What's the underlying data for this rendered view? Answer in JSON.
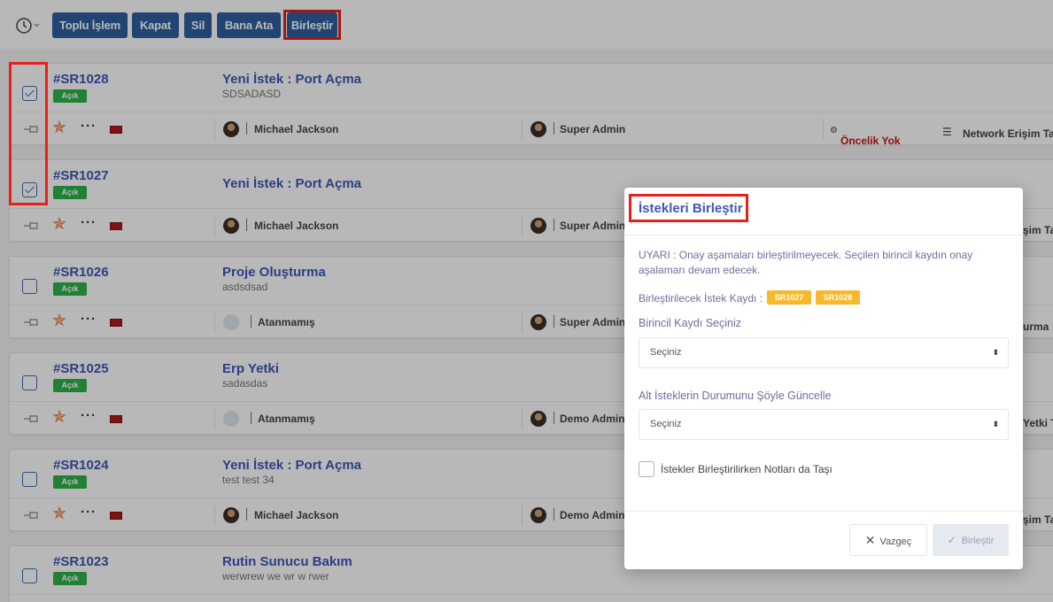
{
  "toolbar": {
    "buttons": [
      "Toplu İşlem",
      "Kapat",
      "Sil",
      "Bana Ata",
      "Birleştir"
    ]
  },
  "requests": [
    {
      "id": "#SR1028",
      "status": "Açık",
      "title": "Yeni İstek : Port Açma",
      "subtitle": "SDSADASD",
      "assignee": "Michael Jackson",
      "owner": "Super Admin",
      "checked": true
    },
    {
      "id": "#SR1027",
      "status": "Açık",
      "title": "Yeni İstek : Port Açma",
      "subtitle": "",
      "assignee": "Michael Jackson",
      "owner": "Super Admin",
      "checked": true
    },
    {
      "id": "#SR1026",
      "status": "Açık",
      "title": "Proje Oluşturma",
      "subtitle": "asdsdsad",
      "assignee": "Atanmamış",
      "owner": "Super Admin",
      "checked": false
    },
    {
      "id": "#SR1025",
      "status": "Açık",
      "title": "Erp Yetki",
      "subtitle": "sadasdas",
      "assignee": "Atanmamış",
      "owner": "Demo Admin",
      "checked": false
    },
    {
      "id": "#SR1024",
      "status": "Açık",
      "title": "Yeni İstek : Port Açma",
      "subtitle": "test test 34",
      "assignee": "Michael Jackson",
      "owner": "Demo Admin",
      "checked": false
    },
    {
      "id": "#SR1023",
      "status": "Açık",
      "title": "Rutin Sunucu Bakım",
      "subtitle": "werwrew we wr w rwer",
      "assignee": "",
      "owner": "",
      "checked": false
    }
  ],
  "first_row_extra": {
    "priority": "Öncelik Yok",
    "category": "Network Erişim Ta"
  },
  "row_clipped_category": [
    "şim Ta",
    "urma",
    "Yetki Ta",
    "şim Ta"
  ],
  "modal": {
    "title": "İstekleri Birleştir",
    "warning": "UYARI : Onay aşamaları birleştirilmeyecek. Seçilen birincil kaydın onay aşalamarı devam edecek.",
    "merge_label": "Birleştirilecek İstek Kaydı :",
    "merge_tags": [
      "SR1027",
      "SR1028"
    ],
    "primary_label": "Birincil Kaydı Seçiniz",
    "primary_select": "Seçiniz",
    "sub_status_label": "Alt İsteklerin Durumunu Şöyle Güncelle",
    "sub_status_select": "Seçiniz",
    "notes_checkbox_label": "İstekler Birleştirilirken Notları da Taşı",
    "cancel": "Vazgeç",
    "merge": "Birleştir"
  },
  "colors": {
    "primary": "#2f5fa0",
    "link": "#3d57b8",
    "open": "#2db34a",
    "tag": "#f6b92b",
    "highlight": "#e8201a"
  }
}
